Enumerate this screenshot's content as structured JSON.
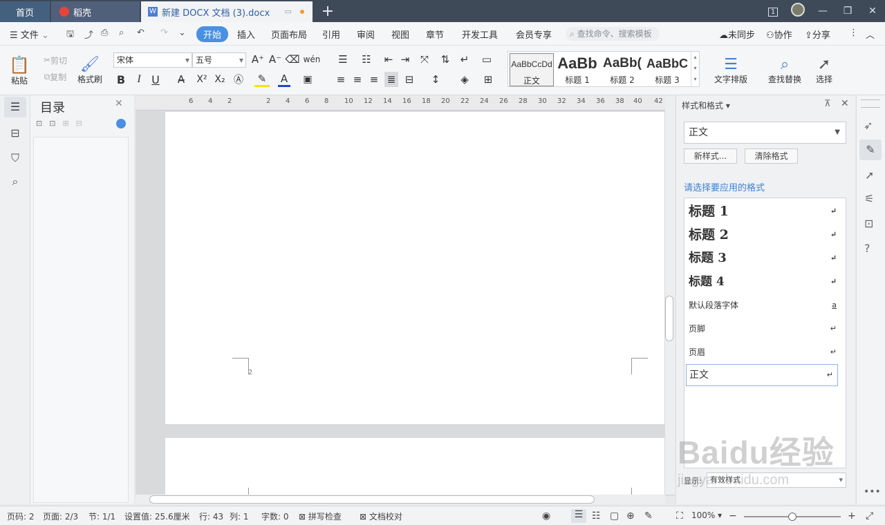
{
  "tabs": {
    "home": "首页",
    "daoke": "稻壳",
    "doc": "新建 DOCX 文档 (3).docx",
    "plus": "+"
  },
  "window_controls": {
    "badge": "1"
  },
  "menu": {
    "file": "文件",
    "items": [
      "开始",
      "插入",
      "页面布局",
      "引用",
      "审阅",
      "视图",
      "章节",
      "开发工具",
      "会员专享"
    ],
    "search": "查找命令、搜索模板",
    "right": [
      "未同步",
      "协作",
      "分享"
    ]
  },
  "toolbar": {
    "paste": "粘贴",
    "cut": "剪切",
    "copy": "复制",
    "format_painter": "格式刷",
    "font": "宋体",
    "size": "五号",
    "bold": "B",
    "italic": "I",
    "underline": "U",
    "styles": [
      {
        "preview": "AaBbCcDd",
        "label": "正文"
      },
      {
        "preview": "AaBb",
        "label": "标题 1"
      },
      {
        "preview": "AaBb(",
        "label": "标题 2"
      },
      {
        "preview": "AaBbC",
        "label": "标题 3"
      }
    ],
    "text_layout": "文字排版",
    "find_replace": "查找替换",
    "select": "选择"
  },
  "toc": {
    "title": "目录"
  },
  "ruler": [
    "6",
    "4",
    "2",
    "2",
    "4",
    "6",
    "8",
    "10",
    "12",
    "14",
    "16",
    "18",
    "20",
    "22",
    "24",
    "26",
    "28",
    "30",
    "32",
    "34",
    "36",
    "38",
    "40",
    "42"
  ],
  "page_number_mark": "2",
  "panel": {
    "title": "样式和格式",
    "current_style": "正文",
    "new_style": "新样式...",
    "clear_format": "清除格式",
    "prompt": "请选择要应用的格式",
    "styles": [
      {
        "label": "标题 1",
        "mark": "↵"
      },
      {
        "label": "标题 2",
        "mark": "↵"
      },
      {
        "label": "标题 3",
        "mark": "↵"
      },
      {
        "label": "标题 4",
        "mark": "↵"
      },
      {
        "label": "默认段落字体",
        "mark": "a"
      },
      {
        "label": "页脚",
        "mark": "↵"
      },
      {
        "label": "页眉",
        "mark": "↵"
      },
      {
        "label": "正文",
        "mark": "↵"
      }
    ],
    "show_label": "显示:",
    "show_value": "有效样式"
  },
  "status": {
    "page_code": "页码: 2",
    "page": "页面: 2/3",
    "section": "节: 1/1",
    "setting": "设置值: 25.6厘米",
    "row": "行: 43",
    "col": "列: 1",
    "words": "字数: 0",
    "spell": "拼写检查",
    "proof": "文档校对",
    "zoom": "100%"
  },
  "watermark": {
    "brand": "Baidu经验",
    "url": "jingyan.baidu.com"
  }
}
